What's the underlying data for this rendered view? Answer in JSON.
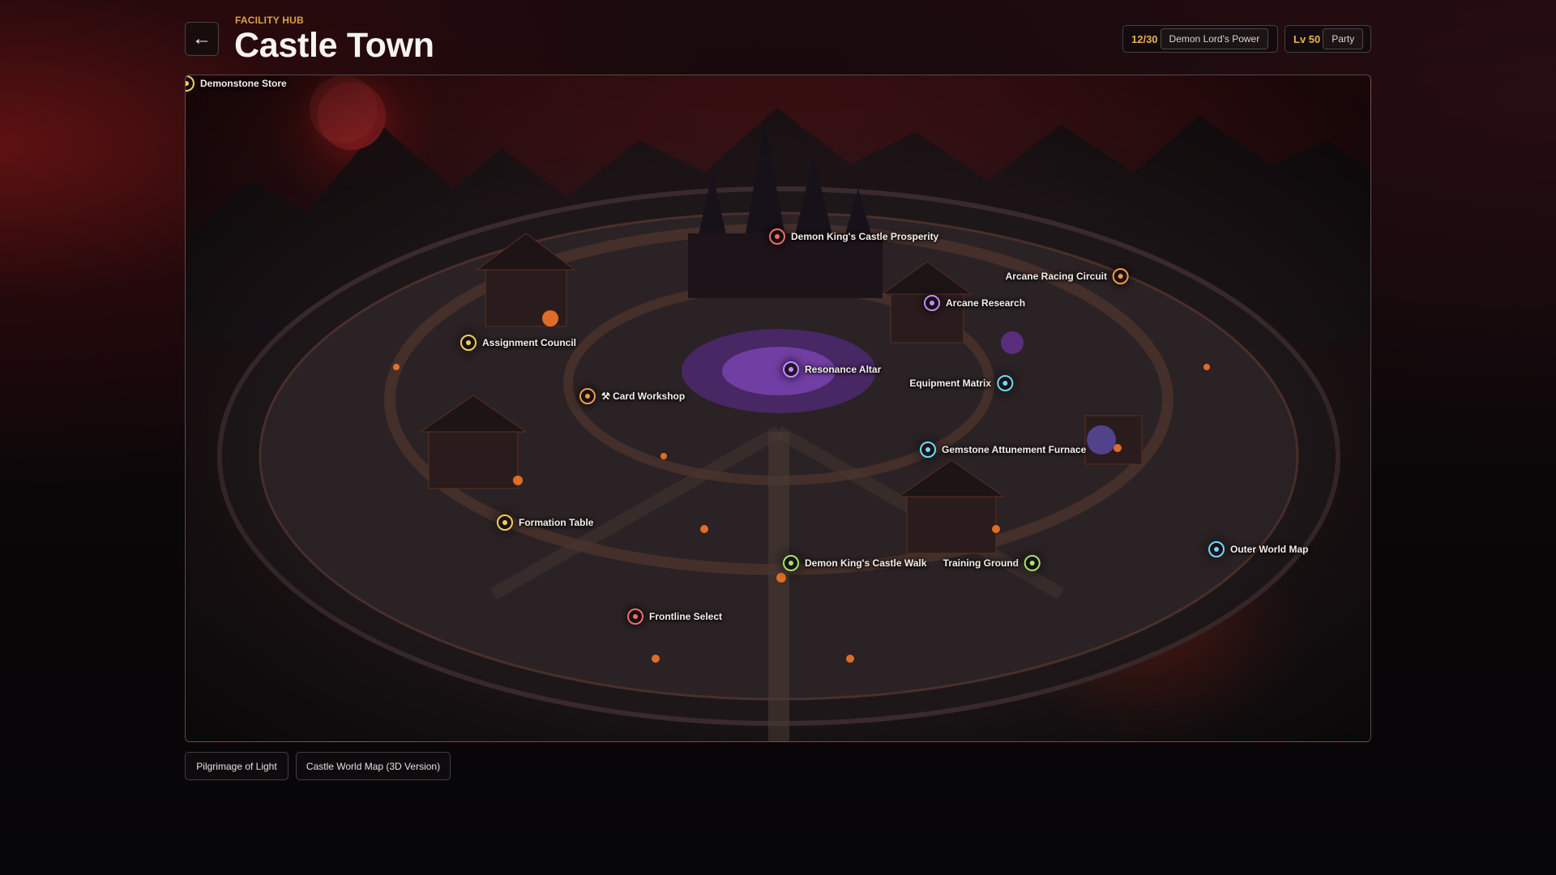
{
  "header": {
    "back_icon": "←",
    "kicker": "FACILITY HUB",
    "title": "Castle Town",
    "power": {
      "value": "12/30",
      "label": "Demon Lord's Power"
    },
    "level": {
      "value": "Lv 50",
      "label": "Party"
    }
  },
  "map": {
    "pois": [
      {
        "name": "Demonstone Store",
        "label": "Demonstone Store",
        "color": "#f2cd61"
      },
      {
        "name": "Demon King's Castle Prosperity",
        "label": "Demon King's Castle Prosperity",
        "color": "#f06b6b"
      },
      {
        "name": "Arcane Racing Circuit",
        "label": "Arcane Racing Circuit",
        "color": "#f39a4a"
      },
      {
        "name": "Arcane Research",
        "label": "Arcane Research",
        "color": "#c38bff"
      },
      {
        "name": "Assignment Council",
        "label": "Assignment Council",
        "color": "#f2cd61"
      },
      {
        "name": "Resonance Altar",
        "label": "Resonance Altar",
        "color": "#c38bff"
      },
      {
        "name": "Equipment Matrix",
        "label": "Equipment Matrix",
        "color": "#6fd8ff"
      },
      {
        "name": "Card Workshop",
        "label": "⚒ Card Workshop",
        "color": "#f39a4a"
      },
      {
        "name": "Gemstone Attunement Furnace",
        "label": "Gemstone Attunement Furnace",
        "color": "#6fd8ff"
      },
      {
        "name": "Formation Table",
        "label": "Formation Table",
        "color": "#f2cd61"
      },
      {
        "name": "Outer World Map",
        "label": "Outer World Map",
        "color": "#6fd8ff"
      },
      {
        "name": "Demon King's Castle Walk",
        "label": "Demon King's Castle Walk",
        "color": "#a6e36f"
      },
      {
        "name": "Training Ground",
        "label": "Training Ground",
        "color": "#a6e36f"
      },
      {
        "name": "Frontline Select",
        "label": "Frontline Select",
        "color": "#f06b6b"
      }
    ]
  },
  "footer": {
    "pilgrimage_label": "Pilgrimage of Light",
    "world_map_label": "Castle World Map (3D Version)"
  },
  "colors": {
    "accent": "#e0a143",
    "level_value": "#e9b24c"
  }
}
